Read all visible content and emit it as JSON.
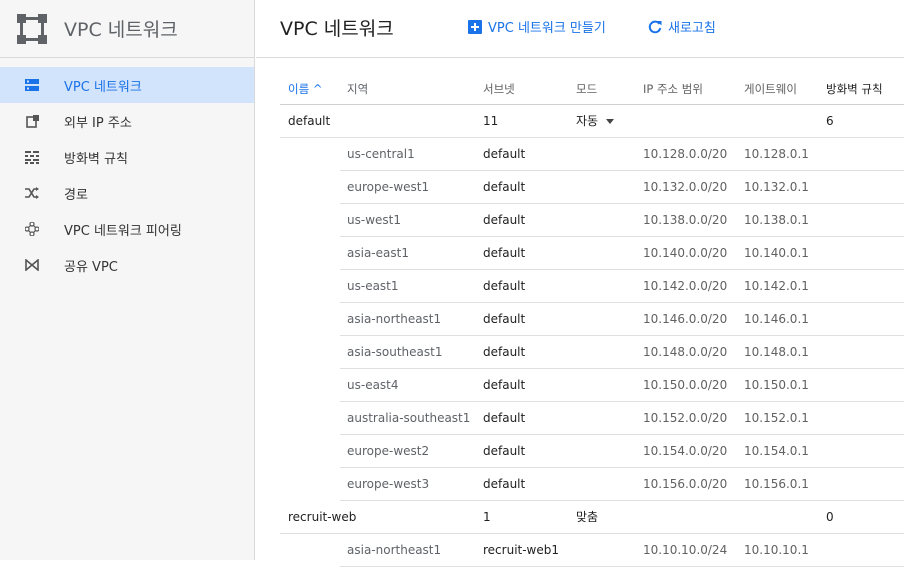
{
  "sidebar": {
    "title": "VPC 네트워크",
    "items": [
      {
        "label": "VPC 네트워크"
      },
      {
        "label": "외부 IP 주소"
      },
      {
        "label": "방화벽 규칙"
      },
      {
        "label": "경로"
      },
      {
        "label": "VPC 네트워크 피어링"
      },
      {
        "label": "공유 VPC"
      }
    ]
  },
  "header": {
    "title": "VPC 네트워크",
    "create_label": "VPC 네트워크 만들기",
    "refresh_label": "새로고침"
  },
  "table": {
    "columns": {
      "name": "이름 ^",
      "region": "지역",
      "subnets": "서브넷",
      "mode": "모드",
      "ip_range": "IP 주소 범위",
      "gateway": "게이트웨이",
      "firewall": "방화벽 규칙"
    },
    "networks": [
      {
        "name": "default",
        "subnet_count": "11",
        "mode": "자동",
        "firewall_rules": "6",
        "subnets": [
          {
            "region": "us-central1",
            "subnet": "default",
            "ip_range": "10.128.0.0/20",
            "gateway": "10.128.0.1"
          },
          {
            "region": "europe-west1",
            "subnet": "default",
            "ip_range": "10.132.0.0/20",
            "gateway": "10.132.0.1"
          },
          {
            "region": "us-west1",
            "subnet": "default",
            "ip_range": "10.138.0.0/20",
            "gateway": "10.138.0.1"
          },
          {
            "region": "asia-east1",
            "subnet": "default",
            "ip_range": "10.140.0.0/20",
            "gateway": "10.140.0.1"
          },
          {
            "region": "us-east1",
            "subnet": "default",
            "ip_range": "10.142.0.0/20",
            "gateway": "10.142.0.1"
          },
          {
            "region": "asia-northeast1",
            "subnet": "default",
            "ip_range": "10.146.0.0/20",
            "gateway": "10.146.0.1"
          },
          {
            "region": "asia-southeast1",
            "subnet": "default",
            "ip_range": "10.148.0.0/20",
            "gateway": "10.148.0.1"
          },
          {
            "region": "us-east4",
            "subnet": "default",
            "ip_range": "10.150.0.0/20",
            "gateway": "10.150.0.1"
          },
          {
            "region": "australia-southeast1",
            "subnet": "default",
            "ip_range": "10.152.0.0/20",
            "gateway": "10.152.0.1"
          },
          {
            "region": "europe-west2",
            "subnet": "default",
            "ip_range": "10.154.0.0/20",
            "gateway": "10.154.0.1"
          },
          {
            "region": "europe-west3",
            "subnet": "default",
            "ip_range": "10.156.0.0/20",
            "gateway": "10.156.0.1"
          }
        ]
      },
      {
        "name": "recruit-web",
        "subnet_count": "1",
        "mode": "맞춤",
        "firewall_rules": "0",
        "subnets": [
          {
            "region": "asia-northeast1",
            "subnet": "recruit-web1",
            "ip_range": "10.10.10.0/24",
            "gateway": "10.10.10.1"
          }
        ]
      }
    ]
  },
  "colors": {
    "accent": "#1a73e8",
    "sidebar_active": "#d2e3fc",
    "logo": "#5f6368"
  }
}
